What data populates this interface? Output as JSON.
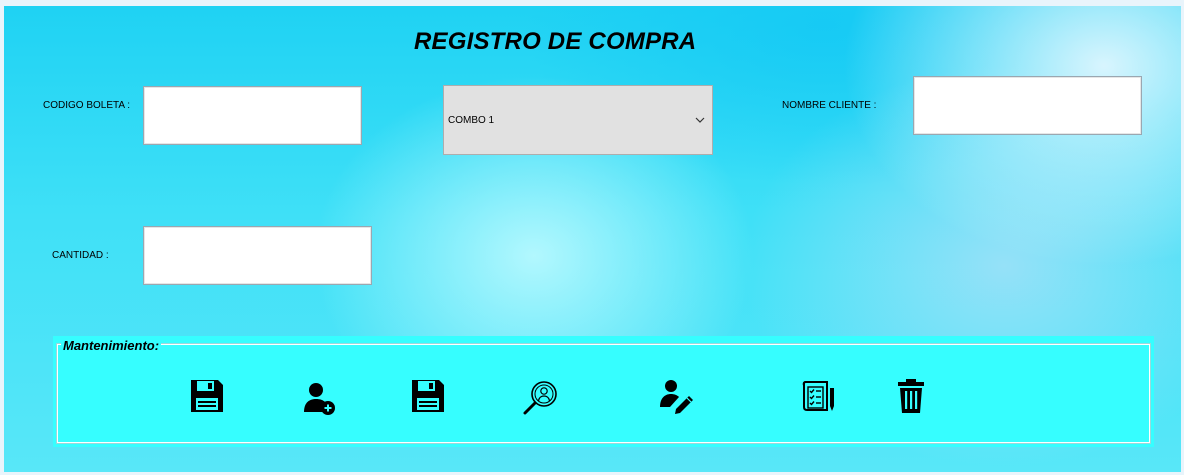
{
  "form": {
    "title": "REGISTRO DE COMPRA",
    "codigo_boleta": {
      "label": "CODIGO BOLETA :",
      "value": ""
    },
    "combo": {
      "selected": "COMBO 1"
    },
    "nombre_cliente": {
      "label": "NOMBRE CLIENTE :",
      "value": ""
    },
    "cantidad": {
      "label": "CANTIDAD :",
      "value": ""
    }
  },
  "maintenance": {
    "legend": "Mantenimiento:",
    "buttons": [
      {
        "icon": "save-icon"
      },
      {
        "icon": "add-user-icon"
      },
      {
        "icon": "save-icon"
      },
      {
        "icon": "search-person-icon"
      },
      {
        "icon": "edit-user-icon"
      },
      {
        "icon": "report-icon"
      },
      {
        "icon": "trash-icon"
      }
    ]
  },
  "colors": {
    "background": "#29d3f5",
    "group_background": "#36feff",
    "combo_background": "#e1e1e1"
  }
}
